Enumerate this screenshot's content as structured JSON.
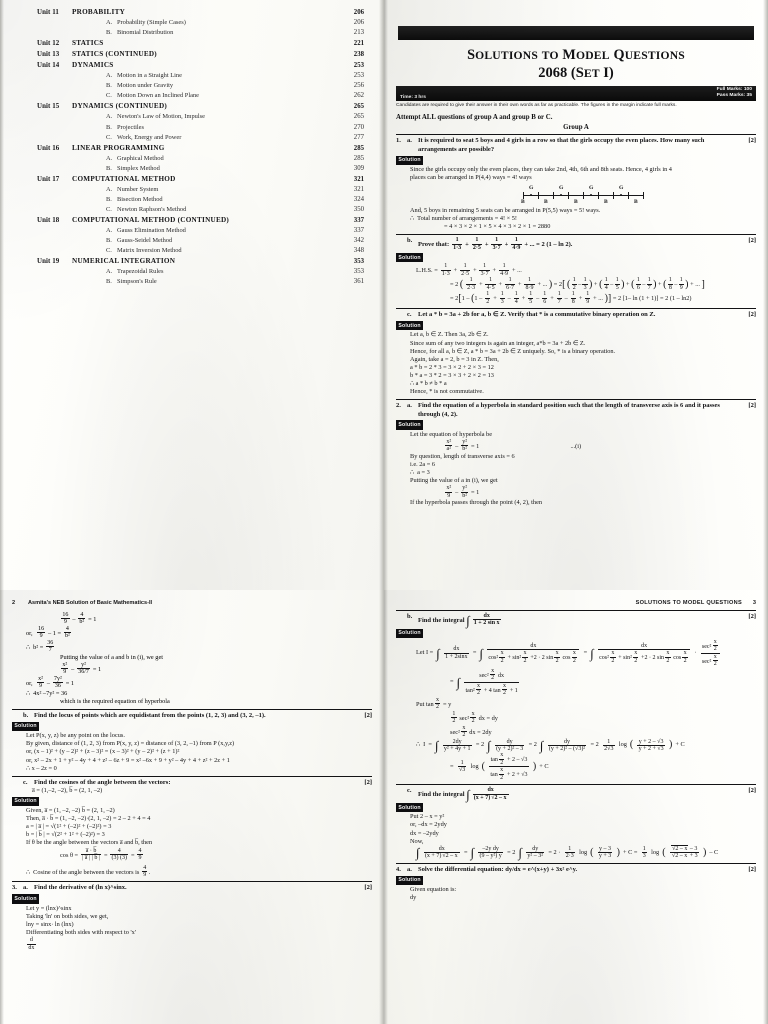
{
  "document": {
    "kind": "scanned-book-spread",
    "book_running_title": "Asmita's NEB Solution of Basic Mathematics-II",
    "section_running_title": "SOLUTIONS TO MODEL QUESTIONS"
  },
  "toc": {
    "rows": [
      {
        "unit": "Unit 11",
        "letter": "",
        "title": "PROBABILITY",
        "page": "206",
        "level": "major"
      },
      {
        "unit": "",
        "letter": "A.",
        "title": "Probability (Simple Cases)",
        "page": "206",
        "level": "sub"
      },
      {
        "unit": "",
        "letter": "B.",
        "title": "Binomial Distribution",
        "page": "213",
        "level": "sub"
      },
      {
        "unit": "Unit 12",
        "letter": "",
        "title": "STATICS",
        "page": "221",
        "level": "major"
      },
      {
        "unit": "Unit 13",
        "letter": "",
        "title": "STATICS (CONTINUED)",
        "page": "238",
        "level": "major"
      },
      {
        "unit": "Unit 14",
        "letter": "",
        "title": "DYNAMICS",
        "page": "253",
        "level": "major"
      },
      {
        "unit": "",
        "letter": "A.",
        "title": "Motion in a Straight Line",
        "page": "253",
        "level": "sub"
      },
      {
        "unit": "",
        "letter": "B.",
        "title": "Motion under Gravity",
        "page": "256",
        "level": "sub"
      },
      {
        "unit": "",
        "letter": "C.",
        "title": "Motion Down an Inclined Plane",
        "page": "262",
        "level": "sub"
      },
      {
        "unit": "Unit 15",
        "letter": "",
        "title": "DYNAMICS (CONTINUED)",
        "page": "265",
        "level": "major"
      },
      {
        "unit": "",
        "letter": "A.",
        "title": "Newton's Law of Motion, Impulse",
        "page": "265",
        "level": "sub"
      },
      {
        "unit": "",
        "letter": "B.",
        "title": "Projectiles",
        "page": "270",
        "level": "sub"
      },
      {
        "unit": "",
        "letter": "C.",
        "title": "Work, Energy and Power",
        "page": "277",
        "level": "sub"
      },
      {
        "unit": "Unit 16",
        "letter": "",
        "title": "LINEAR PROGRAMMING",
        "page": "285",
        "level": "major"
      },
      {
        "unit": "",
        "letter": "A.",
        "title": "Graphical Method",
        "page": "285",
        "level": "sub"
      },
      {
        "unit": "",
        "letter": "B.",
        "title": "Simplex Method",
        "page": "309",
        "level": "sub"
      },
      {
        "unit": "Unit 17",
        "letter": "",
        "title": "COMPUTATIONAL METHOD",
        "page": "321",
        "level": "major"
      },
      {
        "unit": "",
        "letter": "A.",
        "title": "Number System",
        "page": "321",
        "level": "sub"
      },
      {
        "unit": "",
        "letter": "B.",
        "title": "Bisection Method",
        "page": "324",
        "level": "sub"
      },
      {
        "unit": "",
        "letter": "C.",
        "title": "Newton Raphson's Method",
        "page": "350",
        "level": "sub"
      },
      {
        "unit": "Unit 18",
        "letter": "",
        "title": "COMPUTATIONAL METHOD (CONTINUED)",
        "page": "337",
        "level": "major"
      },
      {
        "unit": "",
        "letter": "A.",
        "title": "Gauss Elimination Method",
        "page": "337",
        "level": "sub"
      },
      {
        "unit": "",
        "letter": "B.",
        "title": "Gauss-Seidel Method",
        "page": "342",
        "level": "sub"
      },
      {
        "unit": "",
        "letter": "C.",
        "title": "Matrix Inversion Method",
        "page": "348",
        "level": "sub"
      },
      {
        "unit": "Unit 19",
        "letter": "",
        "title": "NUMERICAL INTEGRATION",
        "page": "353",
        "level": "major"
      },
      {
        "unit": "",
        "letter": "A.",
        "title": "Trapezoidal Rules",
        "page": "353",
        "level": "sub"
      },
      {
        "unit": "",
        "letter": "B.",
        "title": "Simpson's Rule",
        "page": "361",
        "level": "sub"
      }
    ]
  },
  "exam": {
    "title_line1": "SOLUTIONS TO MODEL QUESTIONS",
    "title_line2": "2068 (SET I)",
    "time": "Time: 3 hrs",
    "full_marks": "Full Marks: 100",
    "pass_marks": "Pass Marks: 35",
    "note": "Candidates are required to give their answer in their own words as far as practicable. The figures in the margin indicate full marks.",
    "attempt": "Attempt ALL questions of group A and group B or C.",
    "group": "Group A",
    "solution_label": "Solution"
  },
  "q1a": {
    "num": "1.",
    "letter": "a.",
    "marks": "[2]",
    "text": "It is required to seat 5 boys and 4 girls in a row so that the girls occupy the even places. How many such arrangements are possible?",
    "l1": "Since the girls occupy only the even places, they can take 2nd, 4th, 6th and 8th seats. Hence, 4 girls in 4",
    "l2": "places can be arranged in P(4,4) ways = 4! ways",
    "l3": "And, 5 boys in remaining 5 seats can be arranged in P(5,5) ways = 5! ways.",
    "l4": "Total number of arrangements   = 4! × 5!",
    "l5": "= 4 × 3 × 2 × 1 × 5 × 4 × 3 × 2 × 1 = 2880",
    "diagram": {
      "girl": "G",
      "boy": "B"
    }
  },
  "q1b": {
    "num": "",
    "letter": "b.",
    "marks": "[2]",
    "text_prefix": "Prove that:",
    "text_suffix": "= 2 (1 – ln 2).",
    "lhs": "L.H.S.",
    "series1": [
      "1·3",
      "2·5",
      "3·7",
      "4·9"
    ],
    "series2": [
      "2·3",
      "4·5",
      "6·7",
      "8·9"
    ],
    "pairs": [
      [
        "1",
        "2",
        "1",
        "3"
      ],
      [
        "1",
        "4",
        "1",
        "5"
      ],
      [
        "1",
        "6",
        "1",
        "7"
      ],
      [
        "1",
        "8",
        "1",
        "9"
      ]
    ],
    "bracket_line": "1 – 2 + 3 – 4 + 5 – 6 + 7 – 8 + 9",
    "tail": "= 2 [1– ln (1 + 1)] = 2 (1 – ln2)"
  },
  "q1c": {
    "num": "",
    "letter": "c.",
    "marks": "[2]",
    "text": "Let a * b = 3a + 2b for a, b ∈ Z. Verify that * is a commutative binary operation on Z.",
    "lines": [
      "Let a, b ∈ Z. Then 3a, 2b ∈ Z.",
      "Since sum of any two integers is again an integer, a*b = 3a + 2b ∈ Z.",
      "Hence, for all a, b ∈ Z, a * b = 3a + 2b ∈ Z uniquely. So, * is a binary operation.",
      "Again, take a = 2, b = 3 in Z. Then,",
      "a * b = 2 * 3 = 3 × 2 + 2 × 3 = 12",
      "b * a = 3 * 2 = 3 × 3 + 2 × 2 = 13",
      "a * b ≠ b * a",
      "Hence, * is not commutative."
    ]
  },
  "q2a": {
    "num": "2.",
    "letter": "a.",
    "marks": "[2]",
    "text": "Find the equation of a hyperbola in standard position such that the length of transverse axis is 6 and it passes through (4, 2).",
    "l1": "Let the equation of hyperbola be",
    "eq_ref": "...(i)",
    "l2": "By question, length of transverse axis = 6",
    "l3": "i.e.  2a = 6",
    "l4": "a = 3",
    "l5": "Putting the value of a in (i), we get",
    "l6": "If the hyperbola passes through the point (4, 2), then"
  },
  "page2": {
    "number": "2",
    "cont_lines": [
      "or,",
      "b² =",
      "Putting the value of a and b in (i), we get",
      "or,",
      "4x² –7y² = 36",
      "which is the required equation of hyperbola"
    ]
  },
  "q2b": {
    "num": "",
    "letter": "b.",
    "marks": "[2]",
    "text": "Find the locus of points which are equidistant from the points (1, 2, 3) and (3, 2, –1).",
    "lines": [
      "Let P(x, y, z) be any point on the locus.",
      "By given, distance of (1, 2, 3) from P(x, y, z) = distance of (3, 2, –1) from P (x,y,z)",
      "or,  (x – 1)² + (y – 2)² + (z – 3)² = (x – 3)² + (y – 2)² + (z + 1)²",
      "or,  x² – 2x + 1 + y² – 4y + 4 + z² – 6z + 9 = x² –6x + 9 + y² – 4y + 4 + z² + 2z + 1",
      "x – 2z = 0"
    ]
  },
  "q2c": {
    "num": "",
    "letter": "c.",
    "marks": "[2]",
    "text": "Find the cosines of the angle between the vectors:",
    "vectors": "a̅ = (1,–2, –2), b̅ = (2, 1, –2)",
    "lines": [
      "Given,   a̅ = (1, –2, –2)            b̅ = (2, 1, –2)",
      "Then, a̅ · b̅ = (1, –2, –2)·(2, 1, –2) = 2 – 2 + 4 = 4",
      "a   = | a̅ | = √(1² + (–2)² + (–2)²) = 3",
      "b   = | b̅ | = √(2² + 1² + (–2)²) = 3",
      "If θ be the angle between the vectors a̅ and b̅, then"
    ],
    "cos_result": "cos θ =",
    "conclusion_prefix": "Cosine of the angle between the vectors is",
    "conclusion_frac": [
      "4",
      "9"
    ]
  },
  "q3a": {
    "num": "3.",
    "letter": "a.",
    "marks": "[2]",
    "text": "Find the derivative of (ln x)^sinx.",
    "lines": [
      "Let y = (lnx)^sinx",
      "Taking 'ln' on both sides, we get,",
      "lny = sinx· ln (lnx)",
      "Differentiating both sides with respect to 'x'"
    ]
  },
  "page3": {
    "number": "3",
    "running_title": "SOLUTIONS TO MODEL QUESTIONS"
  },
  "q4b": {
    "num": "",
    "letter": "b.",
    "marks": "[2]",
    "text_prefix": "Find the integral",
    "integrand_num": "dx",
    "integrand_den": "1 + 2 sin x",
    "l_let": "Let I =",
    "l_put": "Put tan x/2 = y",
    "l_sec1": "½ sec² x/2 dx = dy",
    "l_sec2": "sec² x/2 dx = 2dy",
    "tail": "+ C"
  },
  "q4c": {
    "num": "",
    "letter": "c.",
    "marks": "[2]",
    "text_prefix": "Find the integral",
    "integrand_num": "dx",
    "integrand_den": "(x + 7)√(2 – x)",
    "lines": [
      "Put 2 – x = y²",
      "or,  –dx = 2ydy",
      "dx = –2ydy",
      "Now,"
    ],
    "tail": "– C"
  },
  "q4a": {
    "num": "4.",
    "letter": "a.",
    "marks": "[2]",
    "text": "Solve the differential equation:  dy/dx = e^(x+y) + 3x² e^y.",
    "l1": "Given equation is:",
    "l2": "dy"
  }
}
